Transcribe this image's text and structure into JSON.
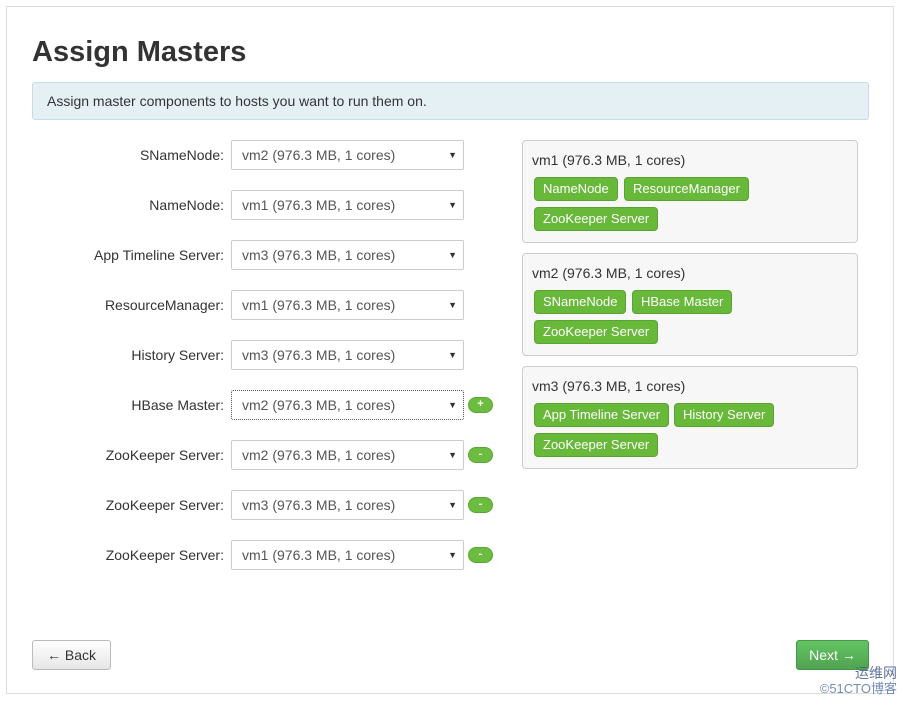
{
  "page": {
    "title": "Assign Masters",
    "info": "Assign master components to hosts you want to run them on."
  },
  "assignments": [
    {
      "label": "SNameNode:",
      "host": "vm2 (976.3 MB, 1 cores)",
      "button": ""
    },
    {
      "label": "NameNode:",
      "host": "vm1 (976.3 MB, 1 cores)",
      "button": ""
    },
    {
      "label": "App Timeline Server:",
      "host": "vm3 (976.3 MB, 1 cores)",
      "button": ""
    },
    {
      "label": "ResourceManager:",
      "host": "vm1 (976.3 MB, 1 cores)",
      "button": ""
    },
    {
      "label": "History Server:",
      "host": "vm3 (976.3 MB, 1 cores)",
      "button": ""
    },
    {
      "label": "HBase Master:",
      "host": "vm2 (976.3 MB, 1 cores)",
      "button": "+"
    },
    {
      "label": "ZooKeeper Server:",
      "host": "vm2 (976.3 MB, 1 cores)",
      "button": "-"
    },
    {
      "label": "ZooKeeper Server:",
      "host": "vm3 (976.3 MB, 1 cores)",
      "button": "-"
    },
    {
      "label": "ZooKeeper Server:",
      "host": "vm1 (976.3 MB, 1 cores)",
      "button": "-"
    }
  ],
  "hosts": [
    {
      "name": "vm1 (976.3 MB, 1 cores)",
      "components": [
        "NameNode",
        "ResourceManager",
        "ZooKeeper Server"
      ]
    },
    {
      "name": "vm2 (976.3 MB, 1 cores)",
      "components": [
        "SNameNode",
        "HBase Master",
        "ZooKeeper Server"
      ]
    },
    {
      "name": "vm3 (976.3 MB, 1 cores)",
      "components": [
        "App Timeline Server",
        "History Server",
        "ZooKeeper Server"
      ]
    }
  ],
  "footer": {
    "back_label": "← Back",
    "next_label": "Next →"
  },
  "watermark": {
    "line1": "运维网",
    "line2": "©51CTO博客"
  },
  "colors": {
    "chip_green": "#68b83a",
    "next_green": "#51a351",
    "alert_bg": "#e5f0f5"
  }
}
